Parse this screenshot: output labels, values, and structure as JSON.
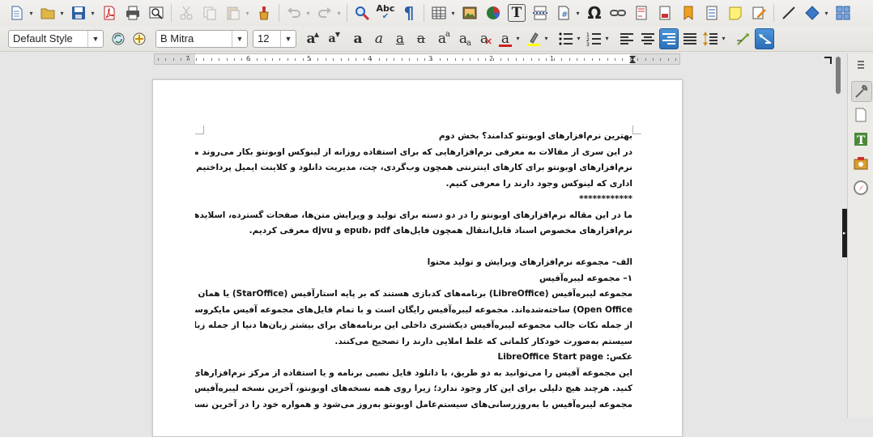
{
  "toolbar1": {
    "tools": [
      {
        "name": "new-document-icon",
        "dropdown": true
      },
      {
        "name": "open-folder-icon",
        "dropdown": true
      },
      {
        "name": "save-icon",
        "dropdown": true
      },
      {
        "name": "export-pdf-icon"
      },
      {
        "name": "print-icon"
      },
      {
        "name": "print-preview-icon"
      },
      {
        "name": "cut-icon",
        "disabled": true
      },
      {
        "name": "copy-icon",
        "disabled": true
      },
      {
        "name": "paste-icon",
        "disabled": true,
        "dropdown": true
      },
      {
        "name": "clone-formatting-icon"
      },
      {
        "name": "undo-icon",
        "disabled": true,
        "dropdown": true
      },
      {
        "name": "redo-icon",
        "disabled": true,
        "dropdown": true
      },
      {
        "name": "find-replace-icon"
      },
      {
        "name": "spelling-icon"
      },
      {
        "name": "formatting-marks-icon"
      },
      {
        "name": "insert-table-icon",
        "dropdown": true
      },
      {
        "name": "insert-image-icon"
      },
      {
        "name": "insert-chart-icon"
      },
      {
        "name": "insert-textbox-icon"
      },
      {
        "name": "page-break-icon"
      },
      {
        "name": "insert-field-icon",
        "dropdown": true
      },
      {
        "name": "special-character-icon"
      },
      {
        "name": "hyperlink-icon"
      },
      {
        "name": "footnote-icon"
      },
      {
        "name": "endnote-icon"
      },
      {
        "name": "bookmark-icon"
      },
      {
        "name": "cross-reference-icon"
      },
      {
        "name": "comment-icon"
      },
      {
        "name": "track-changes-icon"
      },
      {
        "name": "line-icon"
      },
      {
        "name": "basic-shapes-icon",
        "dropdown": true
      },
      {
        "name": "draw-functions-icon"
      }
    ],
    "text_glyphs": {
      "spelling": "Abc",
      "formatting_marks": "¶",
      "special_character": "Ω",
      "textbox": "T"
    }
  },
  "toolbar2": {
    "paragraph_style": "Default Style",
    "font_name": "B Mitra",
    "font_size": "12",
    "format_buttons": [
      {
        "name": "increase-font-size-icon",
        "glyph": "a",
        "sup": "▲"
      },
      {
        "name": "decrease-font-size-icon",
        "glyph": "a",
        "sup": "▼"
      },
      {
        "name": "bold-icon",
        "glyph": "a",
        "style": "bold"
      },
      {
        "name": "italic-icon",
        "glyph": "a",
        "style": "italic"
      },
      {
        "name": "underline-icon",
        "glyph": "a",
        "style": "underline"
      },
      {
        "name": "strikethrough-icon",
        "glyph": "a",
        "style": "strike"
      },
      {
        "name": "superscript-icon",
        "glyph": "a",
        "sup": "a"
      },
      {
        "name": "subscript-icon",
        "glyph": "a",
        "sub": "a"
      },
      {
        "name": "clear-formatting-icon",
        "glyph": "a"
      },
      {
        "name": "font-color-icon",
        "glyph": "a",
        "color": "#c9211e"
      },
      {
        "name": "highlighting-icon",
        "glyph": "",
        "color": "#ffff00"
      }
    ],
    "colors": {
      "font_color": "#c9211e",
      "highlight": "#ffff00",
      "accent": "#2a6fb8"
    }
  },
  "ruler": {
    "numbers": [
      "7",
      "6",
      "5",
      "4",
      "3",
      "2",
      "1"
    ]
  },
  "document": {
    "lines": [
      {
        "t": "بهترین نرم‌افزارهای اوبونتو کدامند؟ بخش دوم",
        "b": true
      },
      {
        "t": "در این سری از مقالات به معرفی نرم‌افزارهایی که برای استفاده روزانه از لینوکس اوبونتو بکار می‌روند می‌پردازیم. در مقاله پیشین به معرفی",
        "b": true
      },
      {
        "t": "نرم‌افزارهای اوبونتو برای کارهای اینترنتی همچون وب‌گردی، چت، مدیریت دانلود و کلاینت ایمیل پرداختیم. در این مقاله قصد داریم نرم‌افزارهای",
        "b": true
      },
      {
        "t": "اداری که لینوکس وجود دارند را معرفی کنیم.",
        "b": true
      },
      {
        "t": "************",
        "b": true
      },
      {
        "t": "ما در این مقاله نرم‌افزارهای اوبونتو را در دو دسته برای تولید و ویرایش متن‌ها، صفحات گسترده، اسلایدهایی ارائه و سخنرانی و پایگاه‌داده و",
        "b": true
      },
      {
        "t": "نرم‌افزارهای مخصوص اسناد قابل‌انتقال همچون فایل‌های epub، pdf و djvu معرفی کردیم.",
        "b": true
      },
      {
        "t": "",
        "b": false
      },
      {
        "t": "الف– مجموعه نرم‌افزارهای ویرایش و تولید محتوا",
        "b": true
      },
      {
        "t": "۱– مجموعه لیبره‌آفیس",
        "b": true
      },
      {
        "t": "مجموعه لیبره‌آفیس (LibreOffice) برنامه‌های کدبازی هستند که بر پایه استارآفیس (StarOffice) یا همان اوپن آفیس شرکت اوراکل (Oracle",
        "b": true
      },
      {
        "t": "Open Office) ساخته‌شده‌اند. مجموعه لیبره‌آفیس رایگان است و با تمام فایل‌های مجموعه آفیس مایکروسافت هم سازگاری دارد",
        "b": true
      },
      {
        "t": "از جمله نکات جالب مجموعه لیبره‌آفیس دیکشنری داخلی این برنامه‌های برای بیشتر زبان‌ها دنیا از جمله زبان فارسی است. با این دیکشنری",
        "b": true
      },
      {
        "t": "سیستم به‌صورت خودکار کلماتی که غلط املایی دارند را تصحیح می‌کنند.",
        "b": true
      },
      {
        "t": "عکس: LibreOffice Start page",
        "b": true
      },
      {
        "t": "این مجموعه آفیس را می‌توانید به دو طریق، با دانلود فایل نصبی برنامه و یا استفاده از مرکز نرم‌افزارهای اوبونتو یا همان دستور apt install نصب",
        "b": true
      },
      {
        "t": "کنید. هرچند هیچ دلیلی برای این کار وجود ندارد؛ زیرا روی همه نسخه‌های اوبونتو، آخرین نسخه لیبره‌آفیس به‌صورت پیش‌فرض نصب‌شده است.",
        "b": true
      },
      {
        "t": "مجموعه لیبره‌آفیس با به‌روزرسانی‌های سیستم‌عامل اوبونتو به‌روز می‌شود و همواره خود را در آخرین نسخه نگاه می‌دارد.",
        "b": true
      }
    ]
  },
  "sidebar": {
    "buttons": [
      {
        "name": "sidebar-menu-icon"
      },
      {
        "name": "properties-icon"
      },
      {
        "name": "page-icon"
      },
      {
        "name": "styles-icon"
      },
      {
        "name": "gallery-icon"
      },
      {
        "name": "navigator-icon"
      }
    ]
  }
}
